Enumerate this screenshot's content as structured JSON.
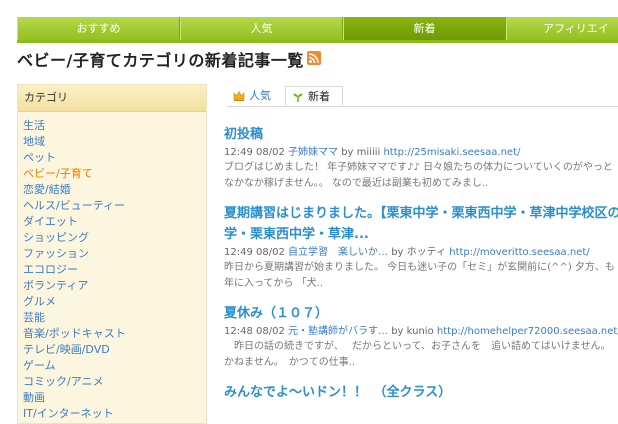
{
  "nav": {
    "tabs": [
      "おすすめ",
      "人気",
      "新着",
      "アフィリエイ"
    ]
  },
  "page": {
    "title": "ベビー/子育てカテゴリの新着記事一覧"
  },
  "sidebar": {
    "heading": "カテゴリ",
    "items": [
      "生活",
      "地域",
      "ペット",
      "ベビー/子育て",
      "恋愛/結婚",
      "ヘルス/ビューティー",
      "ダイエット",
      "ショッピング",
      "ファッション",
      "エコロジー",
      "ボランティア",
      "グルメ",
      "芸能",
      "音楽/ポッドキャスト",
      "テレビ/映画/DVD",
      "ゲーム",
      "コミック/アニメ",
      "動画",
      "IT/インターネット"
    ]
  },
  "subtabs": {
    "popular": "人気",
    "new": "新着"
  },
  "articles": [
    {
      "title": "初投稿",
      "time": "12:49 08/02",
      "category": "子姉妹ママ",
      "by": "by miiiii",
      "url": "http://25misaki.seesaa.net/",
      "excerpt1": "ブログはじめました！ 年子姉妹ママです♪♪ 日々娘たちの体力についていくのがやっと",
      "excerpt2": "なかなか稼げません。。 なので最近は副業も初めてみまし.."
    },
    {
      "title": "夏期講習はじまりました。【栗東中学・栗東西中学・草津中学校区のお",
      "title2": "学・栗東西中学・草津...",
      "time": "12:49 08/02",
      "category": "自立学習　楽しいか…",
      "by": "by ホッティ",
      "url": "http://moveritto.seesaa.net/",
      "excerpt1": "昨日から夏期講習が始まりました。 今日も迷い子の「セミ」が玄関前に(^^) 夕方、も",
      "excerpt2": "年に入ってから 「犬.."
    },
    {
      "title": "夏休み（１０７）",
      "time": "12:48 08/02",
      "category": "元・塾講師がバラす…",
      "by": "by kunio",
      "url": "http://homehelper72000.seesaa.net/",
      "excerpt1": "　昨日の話の続きですが、　 だからといって、お子さんを　追い詰めてはいけません。",
      "excerpt2": "かねません。　かつての仕事.."
    },
    {
      "title": "みんなでよ〜いドン！！　（全クラス）"
    }
  ]
}
